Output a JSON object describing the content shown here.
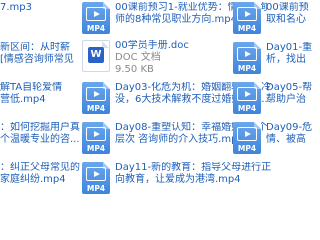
{
  "colors": {
    "link": "#1e5fb8",
    "icon": "#3f84dc",
    "meta": "#8a8a8a"
  },
  "files": [
    {
      "type": "MP4",
      "lines": [
        "00课前预习1-就业优势：情感咨询",
        "师的8种常见职业方向.mp4"
      ]
    },
    {
      "type": "MP4",
      "lines": [
        "00课前预",
        "取和名心"
      ]
    },
    {
      "type": "MP4",
      "lines": [
        "新区间：从时薪",
        "[情感咨询师常见"
      ]
    },
    {
      "type": "DOC",
      "lines": [
        "00学员手册.doc",
        "DOC 文档",
        "9.50 KB"
      ]
    },
    {
      "type": "MP4",
      "lines": [
        "Day01-重",
        "析，找出"
      ]
    },
    {
      "type": "MP4",
      "lines": [
        "解TA自轮爱情",
        "营低.mp4"
      ]
    },
    {
      "type": "MP4",
      "lines": [
        "Day03-化危为机：婚姻翻转的契冷",
        "没，6大技术解救不度过婚姻危机..."
      ]
    },
    {
      "type": "MP4",
      "lines": [
        "Day05-帮",
        "帮助户治"
      ]
    },
    {
      "type": "MP4",
      "lines": [
        "：如何挖掘用户真",
        "个温暖专业的咨..."
      ]
    },
    {
      "type": "MP4",
      "lines": [
        "Day08-重塑认知：幸福婚姻的3个",
        "层次 咨询师的介入技巧.mp4"
      ]
    },
    {
      "type": "MP4",
      "lines": [
        "Day09-危",
        "情、被高"
      ]
    },
    {
      "type": "MP4",
      "lines": [
        "：纠正父母常见的",
        "家庭纠纷.mp4"
      ]
    },
    {
      "type": "MP4",
      "lines": [
        "Day11-新的教育：指导父母进行正",
        "向教育，让爱成为港湾.mp4"
      ]
    }
  ],
  "partial_top_left": "7.mp3"
}
